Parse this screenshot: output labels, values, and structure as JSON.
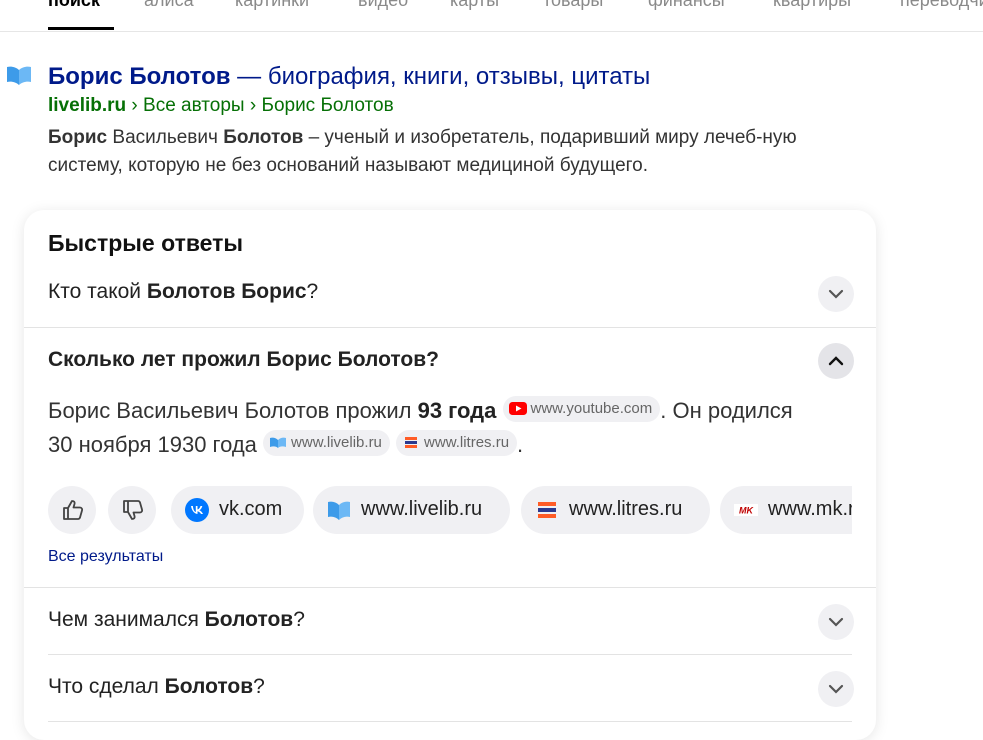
{
  "nav": {
    "tabs": [
      "поиск",
      "алиса",
      "картинки",
      "видео",
      "карты",
      "товары",
      "финансы",
      "квартиры",
      "переводчик"
    ]
  },
  "result": {
    "title_bold": "Борис Болотов",
    "title_rest": " — биография, книги, отзывы, цитаты",
    "host": "livelib.ru",
    "sep1": " › ",
    "crumb1": "Все авторы",
    "sep2": " › ",
    "crumb2": "Борис Болотов",
    "snippet": {
      "b1": "Борис",
      "t1": " Васильевич ",
      "b2": "Болотов",
      "t2": " – ученый и изобретатель, подаривший миру лечеб-ную систему, которую не без оснований называют медициной будущего."
    }
  },
  "quick": {
    "title": "Быстрые ответы",
    "q1": {
      "prefix": "Кто такой ",
      "bold": "Болотов Борис",
      "suffix": "?"
    },
    "q2": "Сколько лет прожил Борис Болотов?",
    "answer": {
      "t1": "Борис Васильевич Болотов прожил ",
      "b1": "93 года",
      "src1": "www.youtube.com",
      "t2": ". Он родился 30 ноября 1930 года",
      "src2": "www.livelib.ru",
      "src3": "www.litres.ru",
      "t3": "."
    },
    "sources": [
      "vk.com",
      "www.livelib.ru",
      "www.litres.ru",
      "www.mk.ru"
    ],
    "all_results": "Все результаты",
    "q3": {
      "prefix": "Чем занимался ",
      "bold": "Болотов",
      "suffix": "?"
    },
    "q4": {
      "prefix": "Что сделал ",
      "bold": "Болотов",
      "suffix": "?"
    }
  },
  "colors": {
    "link": "#001a8a",
    "url_green": "#067006",
    "youtube_red": "#ff0000",
    "vk_blue": "#0077ff",
    "livelib_blue": "#3d9be9",
    "litres_orange": "#ff5c26"
  }
}
